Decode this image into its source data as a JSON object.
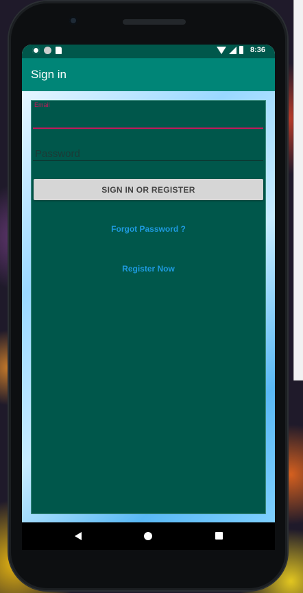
{
  "status_bar": {
    "time": "8:36",
    "left_icons": [
      "settings-icon",
      "circle-icon",
      "sd-card-icon"
    ],
    "right_icons": [
      "wifi-icon",
      "signal-icon",
      "battery-icon"
    ]
  },
  "app_bar": {
    "title": "Sign in",
    "color": "#008577"
  },
  "form": {
    "email_label": "Email",
    "email_value": "",
    "password_placeholder": "Password",
    "signin_button": "SIGN IN OR REGISTER",
    "forgot_link": "Forgot Password ?",
    "register_link": "Register Now"
  },
  "colors": {
    "card": "#00574b",
    "accent": "#c2185b",
    "link": "#1e9be0"
  },
  "nav_bar": {
    "icons": [
      "back-icon",
      "home-icon",
      "recents-icon"
    ]
  }
}
